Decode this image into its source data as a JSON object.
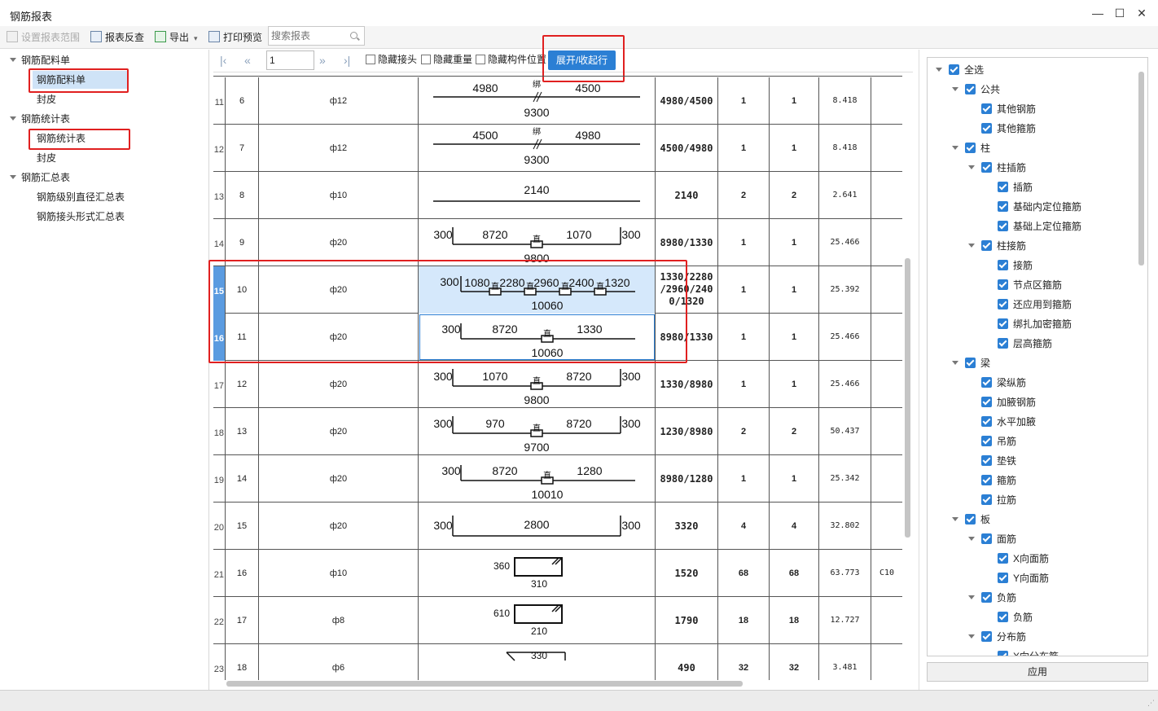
{
  "window": {
    "title": "钢筋报表",
    "controls": [
      "—",
      "☐",
      "✕"
    ]
  },
  "toolbar": {
    "set_range": "设置报表范围",
    "reverse_check": "报表反查",
    "export": "导出",
    "print_preview": "打印预览",
    "search_placeholder": "搜索报表"
  },
  "left_tree": [
    {
      "label": "钢筋配料单",
      "level": 0,
      "expanded": true
    },
    {
      "label": "钢筋配料单",
      "level": 1,
      "selected": true
    },
    {
      "label": "封皮",
      "level": 1
    },
    {
      "label": "钢筋统计表",
      "level": 0,
      "expanded": true
    },
    {
      "label": "钢筋统计表",
      "level": 1
    },
    {
      "label": "封皮",
      "level": 1
    },
    {
      "label": "钢筋汇总表",
      "level": 0,
      "expanded": true
    },
    {
      "label": "钢筋级别直径汇总表",
      "level": 1
    },
    {
      "label": "钢筋接头形式汇总表",
      "level": 1
    }
  ],
  "pager": {
    "page": "1",
    "hide_joint": "隐藏接头",
    "hide_weight": "隐藏重量",
    "hide_position": "隐藏构件位置",
    "expand_button": "展开/收起行"
  },
  "rows": [
    {
      "rn": "11",
      "no": "6",
      "dia": "ф12",
      "len": "4980/4500",
      "c1": "1",
      "c2": "1",
      "wt": "8.418",
      "ex": "",
      "shape": {
        "type": "tie",
        "a": "4980",
        "b": "4500",
        "tag": "绑",
        "total": "9300"
      }
    },
    {
      "rn": "12",
      "no": "7",
      "dia": "ф12",
      "len": "4500/4980",
      "c1": "1",
      "c2": "1",
      "wt": "8.418",
      "ex": "",
      "shape": {
        "type": "tie",
        "a": "4500",
        "b": "4980",
        "tag": "绑",
        "total": "9300"
      }
    },
    {
      "rn": "13",
      "no": "8",
      "dia": "ф10",
      "len": "2140",
      "c1": "2",
      "c2": "2",
      "wt": "2.641",
      "ex": "",
      "shape": {
        "type": "straight",
        "a": "2140"
      }
    },
    {
      "rn": "14",
      "no": "9",
      "dia": "ф20",
      "len": "8980/1330",
      "c1": "1",
      "c2": "1",
      "wt": "25.466",
      "ex": "",
      "shape": {
        "type": "hooked2",
        "l": "300",
        "a": "8720",
        "tag": "直",
        "b": "1070",
        "r": "300",
        "total": "9800"
      }
    },
    {
      "rn": "15",
      "no": "10",
      "dia": "ф20",
      "len": "1330/2280/2960/2400/1320",
      "c1": "1",
      "c2": "1",
      "wt": "25.392",
      "ex": "",
      "hl": true,
      "sel": true,
      "shape": {
        "type": "multi",
        "l": "300",
        "segs": [
          "1080",
          "2280",
          "2960",
          "2400",
          "1320"
        ],
        "tag": "直",
        "total": "10060"
      }
    },
    {
      "rn": "16",
      "no": "11",
      "dia": "ф20",
      "len": "8980/1330",
      "c1": "1",
      "c2": "1",
      "wt": "25.466",
      "ex": "",
      "hl": true,
      "focus": true,
      "shape": {
        "type": "hooked1",
        "l": "300",
        "a": "8720",
        "tag": "直",
        "b": "1330",
        "total": "10060"
      }
    },
    {
      "rn": "17",
      "no": "12",
      "dia": "ф20",
      "len": "1330/8980",
      "c1": "1",
      "c2": "1",
      "wt": "25.466",
      "ex": "",
      "shape": {
        "type": "hooked2",
        "l": "300",
        "a": "1070",
        "tag": "直",
        "b": "8720",
        "r": "300",
        "total": "9800"
      }
    },
    {
      "rn": "18",
      "no": "13",
      "dia": "ф20",
      "len": "1230/8980",
      "c1": "2",
      "c2": "2",
      "wt": "50.437",
      "ex": "",
      "shape": {
        "type": "hooked2",
        "l": "300",
        "a": "970",
        "tag": "直",
        "b": "8720",
        "r": "300",
        "total": "9700"
      }
    },
    {
      "rn": "19",
      "no": "14",
      "dia": "ф20",
      "len": "8980/1280",
      "c1": "1",
      "c2": "1",
      "wt": "25.342",
      "ex": "",
      "shape": {
        "type": "hooked1",
        "l": "300",
        "a": "8720",
        "tag": "直",
        "b": "1280",
        "total": "10010"
      }
    },
    {
      "rn": "20",
      "no": "15",
      "dia": "ф20",
      "len": "3320",
      "c1": "4",
      "c2": "4",
      "wt": "32.802",
      "ex": "",
      "shape": {
        "type": "ushape",
        "l": "300",
        "a": "2800",
        "r": "300"
      }
    },
    {
      "rn": "21",
      "no": "16",
      "dia": "ф10",
      "len": "1520",
      "c1": "68",
      "c2": "68",
      "wt": "63.773",
      "ex": "C10",
      "shape": {
        "type": "stirrup",
        "h": "360",
        "w": "310"
      }
    },
    {
      "rn": "22",
      "no": "17",
      "dia": "ф8",
      "len": "1790",
      "c1": "18",
      "c2": "18",
      "wt": "12.727",
      "ex": "",
      "shape": {
        "type": "stirrup",
        "h": "610",
        "w": "210"
      }
    },
    {
      "rn": "23",
      "no": "18",
      "dia": "ф6",
      "len": "490",
      "c1": "32",
      "c2": "32",
      "wt": "3.481",
      "ex": "",
      "shape": {
        "type": "hook",
        "a": "330"
      }
    }
  ],
  "right_tree": [
    {
      "label": "全选",
      "level": 0,
      "arrow": true
    },
    {
      "label": "公共",
      "level": 1,
      "arrow": true
    },
    {
      "label": "其他钢筋",
      "level": 2
    },
    {
      "label": "其他箍筋",
      "level": 2
    },
    {
      "label": "柱",
      "level": 1,
      "arrow": true
    },
    {
      "label": "柱插筋",
      "level": 2,
      "arrow": true
    },
    {
      "label": "插筋",
      "level": 3
    },
    {
      "label": "基础内定位箍筋",
      "level": 3
    },
    {
      "label": "基础上定位箍筋",
      "level": 3
    },
    {
      "label": "柱接筋",
      "level": 2,
      "arrow": true
    },
    {
      "label": "接筋",
      "level": 3
    },
    {
      "label": "节点区箍筋",
      "level": 3
    },
    {
      "label": "还应用到箍筋",
      "level": 3
    },
    {
      "label": "绑扎加密箍筋",
      "level": 3
    },
    {
      "label": "层高箍筋",
      "level": 3
    },
    {
      "label": "梁",
      "level": 1,
      "arrow": true
    },
    {
      "label": "梁纵筋",
      "level": 2
    },
    {
      "label": "加腋钢筋",
      "level": 2
    },
    {
      "label": "水平加腋",
      "level": 2
    },
    {
      "label": "吊筋",
      "level": 2
    },
    {
      "label": "垫铁",
      "level": 2
    },
    {
      "label": "箍筋",
      "level": 2
    },
    {
      "label": "拉筋",
      "level": 2
    },
    {
      "label": "板",
      "level": 1,
      "arrow": true
    },
    {
      "label": "面筋",
      "level": 2,
      "arrow": true
    },
    {
      "label": "X向面筋",
      "level": 3
    },
    {
      "label": "Y向面筋",
      "level": 3
    },
    {
      "label": "负筋",
      "level": 2,
      "arrow": true
    },
    {
      "label": "负筋",
      "level": 3
    },
    {
      "label": "分布筋",
      "level": 2,
      "arrow": true
    },
    {
      "label": "X向分布筋",
      "level": 3
    }
  ],
  "apply_button": "应用",
  "colors": {
    "accent": "#2b7fd4",
    "highlight": "#e02020",
    "selected_row": "#d5e8fb"
  }
}
